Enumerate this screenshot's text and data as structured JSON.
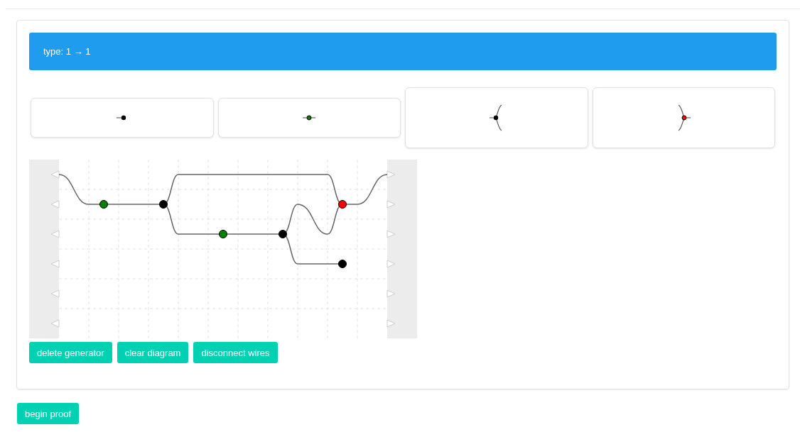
{
  "header": {
    "title": "type: 1 → 1"
  },
  "generators": [
    {
      "kind": "end",
      "color": "#000000"
    },
    {
      "kind": "pass",
      "color": "#008000"
    },
    {
      "kind": "split",
      "color": "#000000"
    },
    {
      "kind": "merge",
      "color": "#ff0000"
    }
  ],
  "diagram": {
    "nodes": [
      {
        "color": "#008000"
      },
      {
        "color": "#000000"
      },
      {
        "color": "#008000"
      },
      {
        "color": "#000000"
      },
      {
        "color": "#ff0000"
      },
      {
        "color": "#000000"
      }
    ]
  },
  "actions": [
    "delete generator",
    "clear diagram",
    "disconnect wires"
  ],
  "footer_button": "begin proof"
}
